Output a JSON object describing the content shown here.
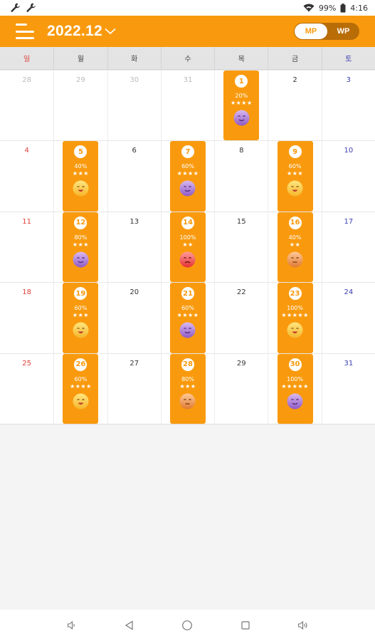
{
  "status_bar": {
    "battery": "99%",
    "time": "4:16"
  },
  "app_bar": {
    "month_title": "2022.12",
    "mp_label": "MP",
    "wp_label": "WP"
  },
  "weekdays": [
    "일",
    "월",
    "화",
    "수",
    "목",
    "금",
    "토"
  ],
  "weeks": [
    [
      {
        "day": "28",
        "other": true
      },
      {
        "day": "29",
        "other": true
      },
      {
        "day": "30",
        "other": true
      },
      {
        "day": "31",
        "other": true
      },
      {
        "day": "1",
        "entry": {
          "percent": "20%",
          "stars": "★★★★",
          "mood": "purple-face"
        }
      },
      {
        "day": "2"
      },
      {
        "day": "3"
      }
    ],
    [
      {
        "day": "4"
      },
      {
        "day": "5",
        "entry": {
          "percent": "40%",
          "stars": "★★★",
          "mood": "yellow-face"
        }
      },
      {
        "day": "6"
      },
      {
        "day": "7",
        "entry": {
          "percent": "60%",
          "stars": "★★★★",
          "mood": "purple-face"
        }
      },
      {
        "day": "8"
      },
      {
        "day": "9",
        "entry": {
          "percent": "60%",
          "stars": "★★★",
          "mood": "yellow-face"
        }
      },
      {
        "day": "10"
      }
    ],
    [
      {
        "day": "11"
      },
      {
        "day": "12",
        "entry": {
          "percent": "80%",
          "stars": "★★★",
          "mood": "purple-face"
        }
      },
      {
        "day": "13"
      },
      {
        "day": "14",
        "entry": {
          "percent": "100%",
          "stars": "★★",
          "mood": "red-face"
        }
      },
      {
        "day": "15"
      },
      {
        "day": "16",
        "entry": {
          "percent": "40%",
          "stars": "★★",
          "mood": "orange-face"
        }
      },
      {
        "day": "17"
      }
    ],
    [
      {
        "day": "18"
      },
      {
        "day": "19",
        "entry": {
          "percent": "60%",
          "stars": "★★★",
          "mood": "yellow-face"
        }
      },
      {
        "day": "20"
      },
      {
        "day": "21",
        "entry": {
          "percent": "60%",
          "stars": "★★★★",
          "mood": "purple-face"
        }
      },
      {
        "day": "22"
      },
      {
        "day": "23",
        "entry": {
          "percent": "100%",
          "stars": "★★★★★",
          "mood": "yellow-face"
        }
      },
      {
        "day": "24"
      }
    ],
    [
      {
        "day": "25"
      },
      {
        "day": "26",
        "entry": {
          "percent": "60%",
          "stars": "★★★★",
          "mood": "yellow-face"
        }
      },
      {
        "day": "27"
      },
      {
        "day": "28",
        "entry": {
          "percent": "80%",
          "stars": "★★★",
          "mood": "orange-face"
        }
      },
      {
        "day": "29"
      },
      {
        "day": "30",
        "entry": {
          "percent": "100%",
          "stars": "★★★★★",
          "mood": "purple-face"
        }
      },
      {
        "day": "31"
      }
    ]
  ],
  "colors": {
    "accent": "#f99a0e",
    "toggle_bg": "#b86d07",
    "sunday": "#e0403a",
    "saturday": "#3b40b0",
    "other_month": "#bbbbbb"
  },
  "icons": [
    "wrench-icon",
    "wifi-icon",
    "battery-icon",
    "menu-icon",
    "chevron-down-icon",
    "volume-down-icon",
    "back-icon",
    "home-icon",
    "recents-icon",
    "volume-up-icon"
  ]
}
